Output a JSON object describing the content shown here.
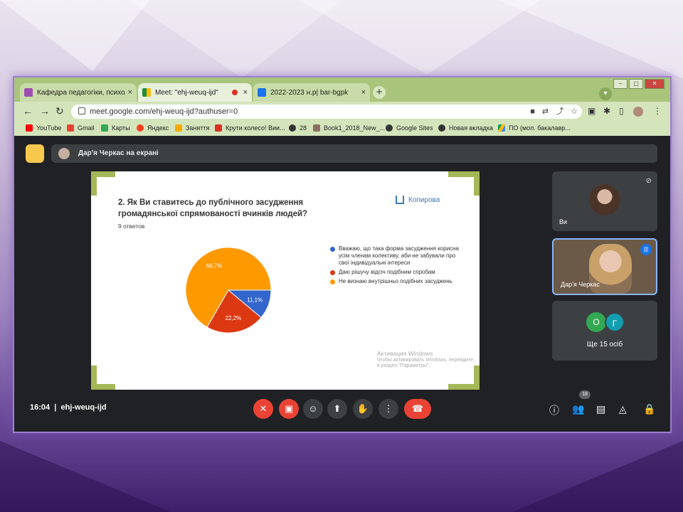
{
  "browser": {
    "tabs": [
      {
        "title": "Кафедра педагогіки, психології",
        "close": "×",
        "color": "#9c4fb0"
      },
      {
        "title": "Meet: \"ehj-weuq-ijd\"",
        "close": "×",
        "color": "#1e8e3e"
      },
      {
        "title": "2022-2023 н.р| bar-bgpk",
        "close": "×",
        "color": "#1a73e8"
      }
    ],
    "new_tab": "+",
    "url": "meet.google.com/ehj-weuq-ijd?authuser=0",
    "bookmarks": [
      "YouTube",
      "Gmail",
      "Карты",
      "Яндекс",
      "Заняття",
      "Крути колесо! Вии...",
      "28",
      "Book1_2018_New_...",
      "Google Sites",
      "Новая вкладка",
      "ПО (мол. бакалавр..."
    ]
  },
  "meet": {
    "presenting_label": "Дар'я Черкас на екрані",
    "meeting_code": "ehj-weuq-ijd",
    "time": "16:04",
    "participants_count": "18",
    "tiles": [
      {
        "name": "Ви"
      },
      {
        "name": "Дар'я Черкас"
      },
      {
        "name": "Ще 15 осіб",
        "initials": [
          "О",
          "Г"
        ]
      }
    ]
  },
  "slide": {
    "question": "2. Як Ви ставитесь  до публічного засудження громадянської спрямованості вчинків людей?",
    "responses": "9 ответов",
    "logo": "Копирова",
    "watermark_title": "Активация Windows",
    "watermark_text": "Чтобы активировать Windows, перейдите в раздел \"Параметры\"."
  },
  "chart_data": {
    "type": "pie",
    "title": "2. Як Ви ставитесь  до публічного засудження громадянської спрямованості вчинків людей?",
    "categories": [
      "Вважаю, що така форма засудження корисна усім членам колективу, аби не забували про свої індивідуальні інтереси",
      "Даю рішучу відсіч подібним спробам",
      "Не визнаю внутрішньо подібних засуджень"
    ],
    "values": [
      11.1,
      22.2,
      66.7
    ],
    "labels": [
      "11,1%",
      "22,2%",
      "66,7%"
    ],
    "colors": [
      "#3366cc",
      "#dc3912",
      "#ff9900"
    ],
    "legend": "right"
  }
}
